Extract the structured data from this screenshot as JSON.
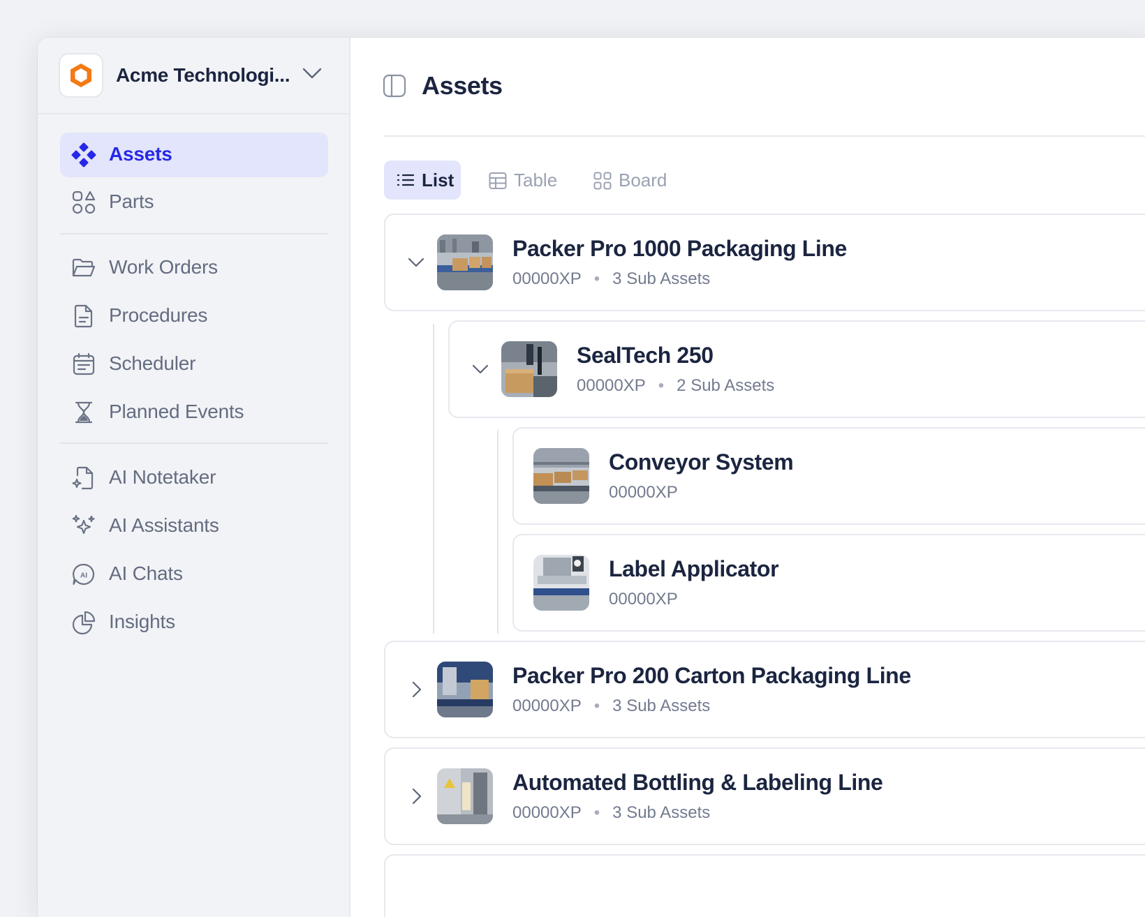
{
  "org": {
    "name": "Acme Technologi...",
    "logo_icon": "hexagon-logo-icon",
    "accent": "#f47a14"
  },
  "sidebar": {
    "items": [
      {
        "label": "Assets",
        "icon": "assets-diamond-icon",
        "active": true
      },
      {
        "label": "Parts",
        "icon": "shapes-icon"
      },
      {
        "label": "Work Orders",
        "icon": "folder-open-icon"
      },
      {
        "label": "Procedures",
        "icon": "document-icon"
      },
      {
        "label": "Scheduler",
        "icon": "calendar-icon"
      },
      {
        "label": "Planned Events",
        "icon": "hourglass-icon"
      },
      {
        "label": "AI Notetaker",
        "icon": "note-sparkle-icon"
      },
      {
        "label": "AI Assistants",
        "icon": "sparkles-icon"
      },
      {
        "label": "AI Chats",
        "icon": "ai-chat-icon"
      },
      {
        "label": "Insights",
        "icon": "pie-chart-icon"
      }
    ]
  },
  "page": {
    "title": "Assets"
  },
  "views": [
    {
      "label": "List",
      "active": true
    },
    {
      "label": "Table"
    },
    {
      "label": "Board"
    }
  ],
  "assets": [
    {
      "name": "Packer Pro 1000 Packaging Line",
      "code": "00000XP",
      "sub": "3 Sub Assets",
      "expanded": true
    },
    {
      "name": "SealTech 250",
      "code": "00000XP",
      "sub": "2 Sub Assets",
      "expanded": true
    },
    {
      "name": "Conveyor System",
      "code": "00000XP"
    },
    {
      "name": "Label Applicator",
      "code": "00000XP"
    },
    {
      "name": "Packer Pro 200 Carton Packaging Line",
      "code": "00000XP",
      "sub": "3 Sub Assets",
      "expanded": false
    },
    {
      "name": "Automated Bottling & Labeling Line",
      "code": "00000XP",
      "sub": "3 Sub Assets",
      "expanded": false
    }
  ],
  "colors": {
    "active_blue": "#2727e8",
    "active_bg": "#e2e5fb",
    "text_dark": "#1b2540",
    "text_muted": "#636c81"
  }
}
